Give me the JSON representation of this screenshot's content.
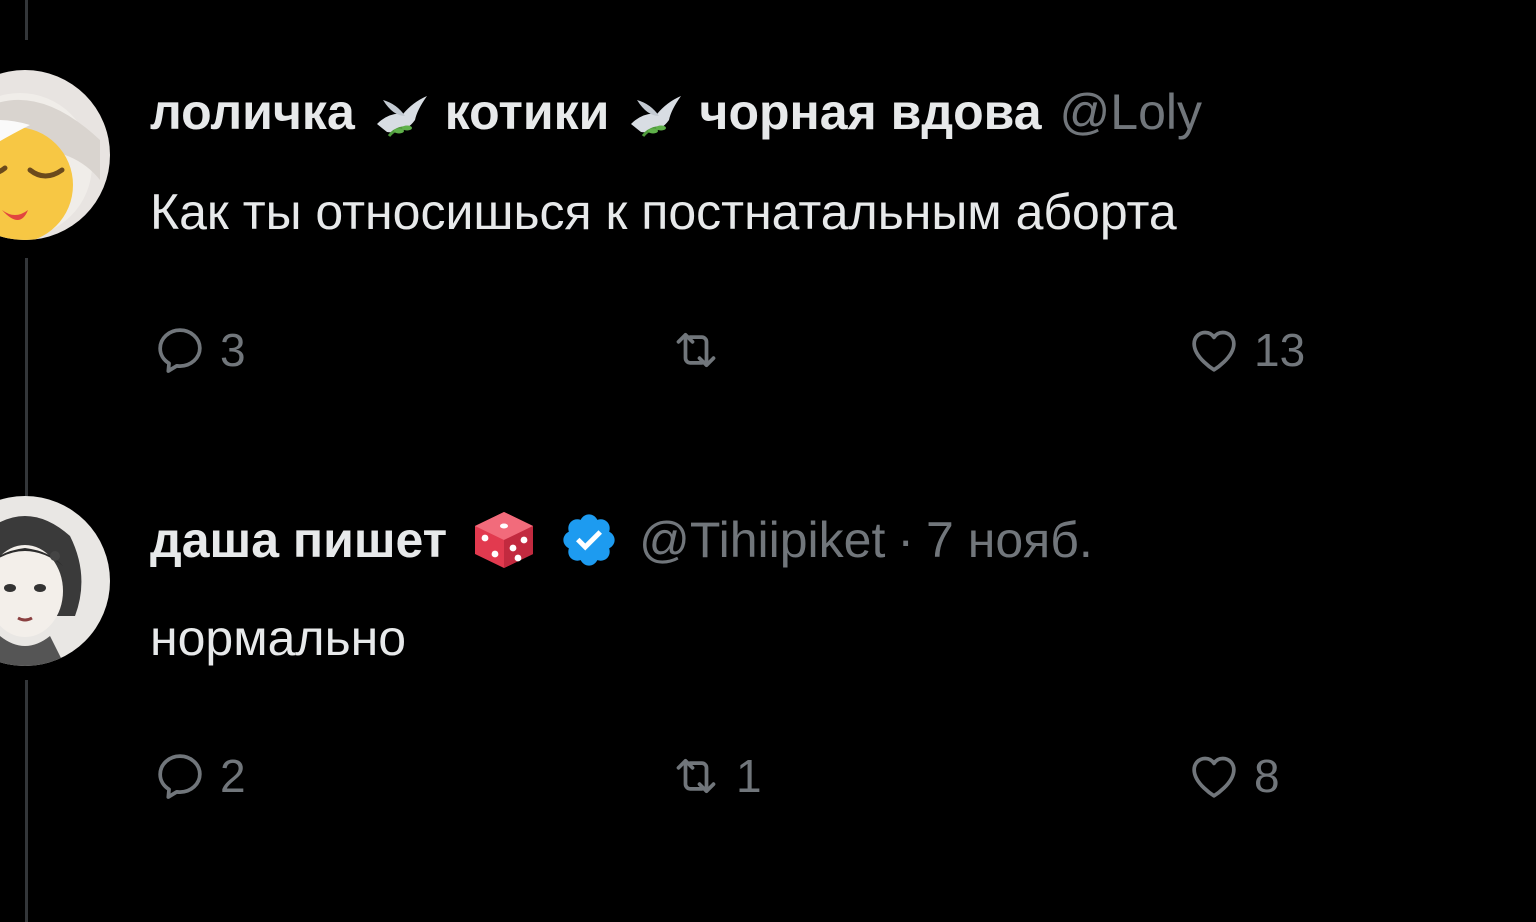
{
  "tweets": [
    {
      "display_name": "лоличка",
      "emoji_1": "dove-with-olive-branch-icon",
      "name_part_2": "котики",
      "emoji_2": "dove-with-olive-branch-icon",
      "name_part_3": "чорная вдова",
      "handle": "@Loly",
      "text": "Как ты относишься к постнатальным аборта",
      "replies": "3",
      "retweets": "",
      "likes": "13"
    },
    {
      "display_name": "даша пишет",
      "emoji_1": "dice-icon",
      "verified": "verified-badge-icon",
      "handle": "@Tihiipiket",
      "separator": "·",
      "date": "7 нояб.",
      "text": "нормально",
      "replies": "2",
      "retweets": "1",
      "likes": "8"
    }
  ],
  "colors": {
    "background": "#000000",
    "text_primary": "#e7e9ea",
    "text_secondary": "#71767b",
    "verified_blue": "#1d9bf0",
    "thread_line": "#333639"
  }
}
